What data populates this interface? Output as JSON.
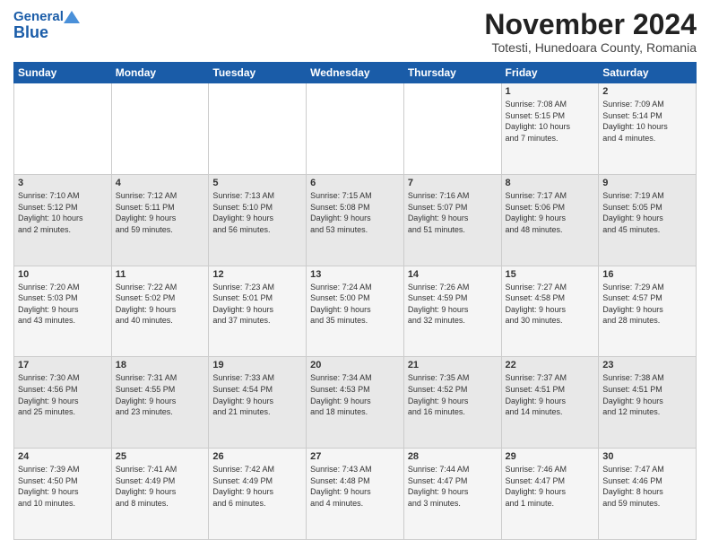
{
  "header": {
    "logo_general": "General",
    "logo_blue": "Blue",
    "month_title": "November 2024",
    "location": "Totesti, Hunedoara County, Romania"
  },
  "weekdays": [
    "Sunday",
    "Monday",
    "Tuesday",
    "Wednesday",
    "Thursday",
    "Friday",
    "Saturday"
  ],
  "weeks": [
    [
      {
        "day": "",
        "info": ""
      },
      {
        "day": "",
        "info": ""
      },
      {
        "day": "",
        "info": ""
      },
      {
        "day": "",
        "info": ""
      },
      {
        "day": "",
        "info": ""
      },
      {
        "day": "1",
        "info": "Sunrise: 7:08 AM\nSunset: 5:15 PM\nDaylight: 10 hours\nand 7 minutes."
      },
      {
        "day": "2",
        "info": "Sunrise: 7:09 AM\nSunset: 5:14 PM\nDaylight: 10 hours\nand 4 minutes."
      }
    ],
    [
      {
        "day": "3",
        "info": "Sunrise: 7:10 AM\nSunset: 5:12 PM\nDaylight: 10 hours\nand 2 minutes."
      },
      {
        "day": "4",
        "info": "Sunrise: 7:12 AM\nSunset: 5:11 PM\nDaylight: 9 hours\nand 59 minutes."
      },
      {
        "day": "5",
        "info": "Sunrise: 7:13 AM\nSunset: 5:10 PM\nDaylight: 9 hours\nand 56 minutes."
      },
      {
        "day": "6",
        "info": "Sunrise: 7:15 AM\nSunset: 5:08 PM\nDaylight: 9 hours\nand 53 minutes."
      },
      {
        "day": "7",
        "info": "Sunrise: 7:16 AM\nSunset: 5:07 PM\nDaylight: 9 hours\nand 51 minutes."
      },
      {
        "day": "8",
        "info": "Sunrise: 7:17 AM\nSunset: 5:06 PM\nDaylight: 9 hours\nand 48 minutes."
      },
      {
        "day": "9",
        "info": "Sunrise: 7:19 AM\nSunset: 5:05 PM\nDaylight: 9 hours\nand 45 minutes."
      }
    ],
    [
      {
        "day": "10",
        "info": "Sunrise: 7:20 AM\nSunset: 5:03 PM\nDaylight: 9 hours\nand 43 minutes."
      },
      {
        "day": "11",
        "info": "Sunrise: 7:22 AM\nSunset: 5:02 PM\nDaylight: 9 hours\nand 40 minutes."
      },
      {
        "day": "12",
        "info": "Sunrise: 7:23 AM\nSunset: 5:01 PM\nDaylight: 9 hours\nand 37 minutes."
      },
      {
        "day": "13",
        "info": "Sunrise: 7:24 AM\nSunset: 5:00 PM\nDaylight: 9 hours\nand 35 minutes."
      },
      {
        "day": "14",
        "info": "Sunrise: 7:26 AM\nSunset: 4:59 PM\nDaylight: 9 hours\nand 32 minutes."
      },
      {
        "day": "15",
        "info": "Sunrise: 7:27 AM\nSunset: 4:58 PM\nDaylight: 9 hours\nand 30 minutes."
      },
      {
        "day": "16",
        "info": "Sunrise: 7:29 AM\nSunset: 4:57 PM\nDaylight: 9 hours\nand 28 minutes."
      }
    ],
    [
      {
        "day": "17",
        "info": "Sunrise: 7:30 AM\nSunset: 4:56 PM\nDaylight: 9 hours\nand 25 minutes."
      },
      {
        "day": "18",
        "info": "Sunrise: 7:31 AM\nSunset: 4:55 PM\nDaylight: 9 hours\nand 23 minutes."
      },
      {
        "day": "19",
        "info": "Sunrise: 7:33 AM\nSunset: 4:54 PM\nDaylight: 9 hours\nand 21 minutes."
      },
      {
        "day": "20",
        "info": "Sunrise: 7:34 AM\nSunset: 4:53 PM\nDaylight: 9 hours\nand 18 minutes."
      },
      {
        "day": "21",
        "info": "Sunrise: 7:35 AM\nSunset: 4:52 PM\nDaylight: 9 hours\nand 16 minutes."
      },
      {
        "day": "22",
        "info": "Sunrise: 7:37 AM\nSunset: 4:51 PM\nDaylight: 9 hours\nand 14 minutes."
      },
      {
        "day": "23",
        "info": "Sunrise: 7:38 AM\nSunset: 4:51 PM\nDaylight: 9 hours\nand 12 minutes."
      }
    ],
    [
      {
        "day": "24",
        "info": "Sunrise: 7:39 AM\nSunset: 4:50 PM\nDaylight: 9 hours\nand 10 minutes."
      },
      {
        "day": "25",
        "info": "Sunrise: 7:41 AM\nSunset: 4:49 PM\nDaylight: 9 hours\nand 8 minutes."
      },
      {
        "day": "26",
        "info": "Sunrise: 7:42 AM\nSunset: 4:49 PM\nDaylight: 9 hours\nand 6 minutes."
      },
      {
        "day": "27",
        "info": "Sunrise: 7:43 AM\nSunset: 4:48 PM\nDaylight: 9 hours\nand 4 minutes."
      },
      {
        "day": "28",
        "info": "Sunrise: 7:44 AM\nSunset: 4:47 PM\nDaylight: 9 hours\nand 3 minutes."
      },
      {
        "day": "29",
        "info": "Sunrise: 7:46 AM\nSunset: 4:47 PM\nDaylight: 9 hours\nand 1 minute."
      },
      {
        "day": "30",
        "info": "Sunrise: 7:47 AM\nSunset: 4:46 PM\nDaylight: 8 hours\nand 59 minutes."
      }
    ]
  ]
}
